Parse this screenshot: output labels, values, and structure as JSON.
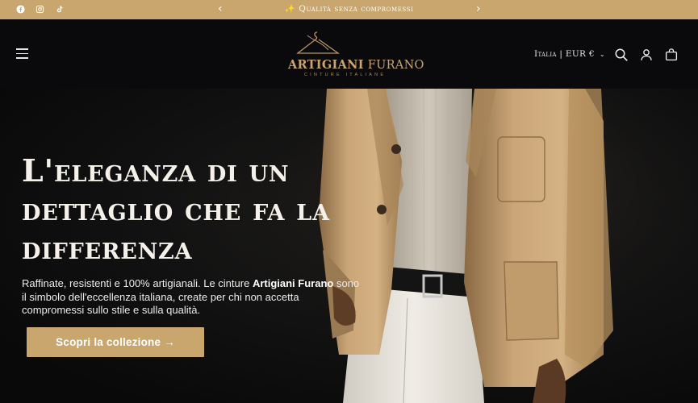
{
  "topbar": {
    "announcement": "Qualità senza compromessi",
    "spark_icon": "✨",
    "prev_arrow": "‹",
    "next_arrow": "›",
    "socials": [
      "facebook-icon",
      "instagram-icon",
      "tiktok-icon"
    ]
  },
  "header": {
    "logo_main": "ARTIGIANI",
    "logo_second": "FURANO",
    "logo_sub": "CINTURE ITALIANE",
    "region_label": "Italia | EUR €",
    "region_chevron": "⌄"
  },
  "hero": {
    "title": "L'eleganza di un dettaglio che fa la differenza",
    "text_before": "Raffinate, resistenti e 100% artigianali. Le cinture ",
    "text_brand": "Artigiani Furano",
    "text_after": " sono il simbolo dell'eccellenza italiana, create per chi non accetta compromessi sullo stile e sulla qualità.",
    "cta_label": "Scopri la collezione →"
  },
  "colors": {
    "accent_gold": "#c8a66e",
    "header_bg": "#0a0a0c",
    "hero_text": "#f4f1ea"
  }
}
